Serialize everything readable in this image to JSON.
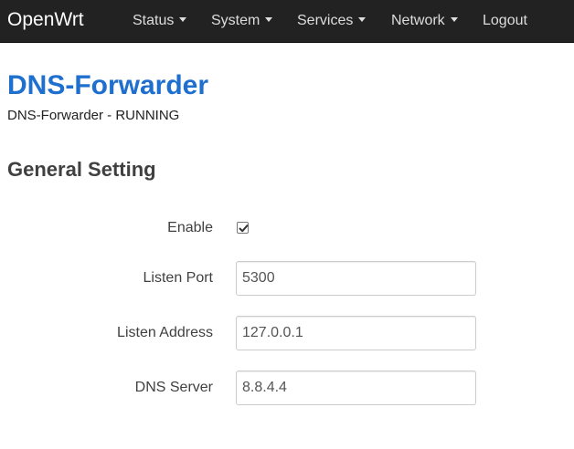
{
  "navbar": {
    "brand": "OpenWrt",
    "menu": [
      {
        "label": "Status",
        "has_dropdown": true
      },
      {
        "label": "System",
        "has_dropdown": true
      },
      {
        "label": "Services",
        "has_dropdown": true
      },
      {
        "label": "Network",
        "has_dropdown": true
      },
      {
        "label": "Logout",
        "has_dropdown": false
      }
    ]
  },
  "page": {
    "title": "DNS-Forwarder",
    "description": "DNS-Forwarder - RUNNING"
  },
  "section": {
    "title": "General Setting",
    "fields": {
      "enable": {
        "label": "Enable",
        "checked": true
      },
      "listen_port": {
        "label": "Listen Port",
        "value": "5300"
      },
      "listen_address": {
        "label": "Listen Address",
        "value": "127.0.0.1"
      },
      "dns_server": {
        "label": "DNS Server",
        "value": "8.8.4.4"
      }
    }
  },
  "colors": {
    "navbar_bg": "#222222",
    "title_blue": "#1e6fce"
  }
}
